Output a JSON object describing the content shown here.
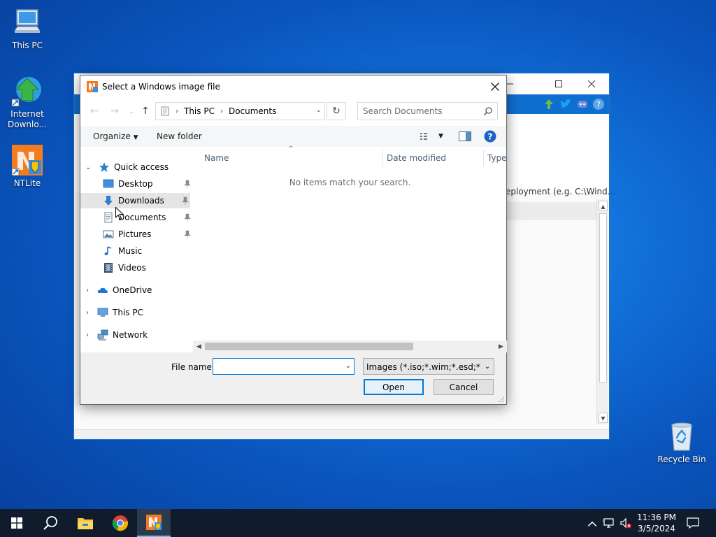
{
  "desktop": {
    "icons": [
      {
        "label": "This PC"
      },
      {
        "label": "Internet\nDownlo..."
      },
      {
        "label": "NTLite"
      },
      {
        "label": "Recycle Bin"
      }
    ]
  },
  "background_window": {
    "partial_label": "eployment (e.g. C:\\Wind..."
  },
  "dialog": {
    "title": "Select a Windows image file",
    "breadcrumb": [
      "This PC",
      "Documents"
    ],
    "search_placeholder": "Search Documents",
    "toolbar": {
      "organize": "Organize",
      "new_folder": "New folder"
    },
    "tree": {
      "quick_access": "Quick access",
      "desktop": "Desktop",
      "downloads": "Downloads",
      "documents": "Documents",
      "pictures": "Pictures",
      "music": "Music",
      "videos": "Videos",
      "onedrive": "OneDrive",
      "this_pc": "This PC",
      "network": "Network"
    },
    "columns": {
      "name": "Name",
      "date_modified": "Date modified",
      "type": "Type"
    },
    "empty_message": "No items match your search.",
    "file_name_label": "File name:",
    "file_name_value": "",
    "filter": "Images (*.iso;*.wim;*.esd;*.swm",
    "open_label": "Open",
    "cancel_label": "Cancel"
  },
  "taskbar": {
    "time": "11:36 PM",
    "date": "3/5/2024"
  },
  "colors": {
    "accent": "#0078d7",
    "taskbar": "#101c2b",
    "ribbon": "#0f6fd0"
  }
}
